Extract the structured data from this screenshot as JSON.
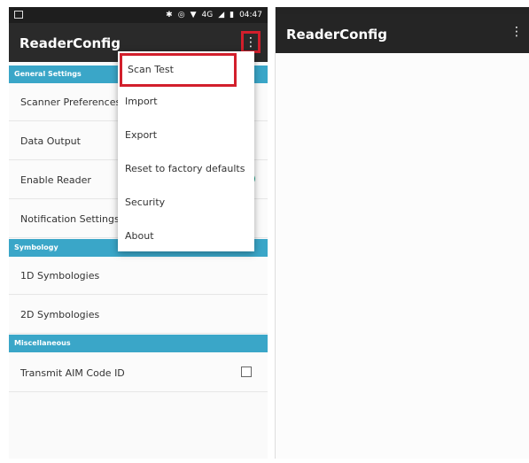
{
  "left_screen": {
    "status_bar": {
      "icons": [
        "bluetooth-icon",
        "sync-icon",
        "wifi-icon",
        "signal-icon",
        "battery-icon"
      ],
      "network": "4G",
      "time": "04:47"
    },
    "toolbar": {
      "title": "ReaderConfig",
      "overflow_icon": "⋮"
    },
    "sections": [
      {
        "header": "General Settings",
        "items": [
          "Scanner Preferences",
          "Data Output",
          "Enable Reader",
          "Notification Settings"
        ]
      },
      {
        "header": "Symbology",
        "items": [
          "1D Symbologies",
          "2D Symbologies"
        ]
      },
      {
        "header": "Miscellaneous",
        "items": [
          "Transmit AIM Code ID"
        ]
      }
    ],
    "colors": {
      "toolbar": "#2a2a2a",
      "section_header": "#3aa6c8",
      "highlight": "#d21f2c",
      "toggle": "#2aa28a"
    }
  },
  "overflow_menu": {
    "items": [
      "Scan Test",
      "Import",
      "Export",
      "Reset to factory defaults",
      "Security",
      "About"
    ],
    "selected_index": 0
  },
  "right_screen": {
    "toolbar": {
      "title": "ReaderConfig",
      "overflow_icon": "⋮"
    }
  }
}
